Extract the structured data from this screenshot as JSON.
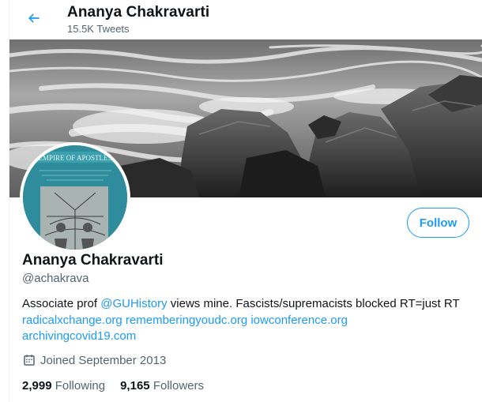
{
  "header": {
    "name": "Ananya Chakravarti",
    "tweet_count": "15.5K Tweets"
  },
  "profile": {
    "name": "Ananya Chakravarti",
    "handle": "@achakrava",
    "follow_label": "Follow",
    "bio_prefix": "Associate prof ",
    "bio_mention": "@GUHistory",
    "bio_suffix": " views mine. Fascists/supremacists blocked RT=just RT",
    "links": [
      "radicalxchange.org",
      "rememberingyoudc.org",
      "iowconference.org",
      "archivingcovid19.com"
    ],
    "joined": "Joined September 2013",
    "following_count": "2,999",
    "following_label": "Following",
    "followers_count": "9,165",
    "followers_label": "Followers",
    "avatar_book_title": "EMPIRE OF APOSTLES"
  },
  "colors": {
    "accent": "#1d9bf0",
    "muted_text": "#536471",
    "primary_text": "#0f1419"
  },
  "icons": [
    "back-arrow-icon",
    "calendar-icon"
  ]
}
